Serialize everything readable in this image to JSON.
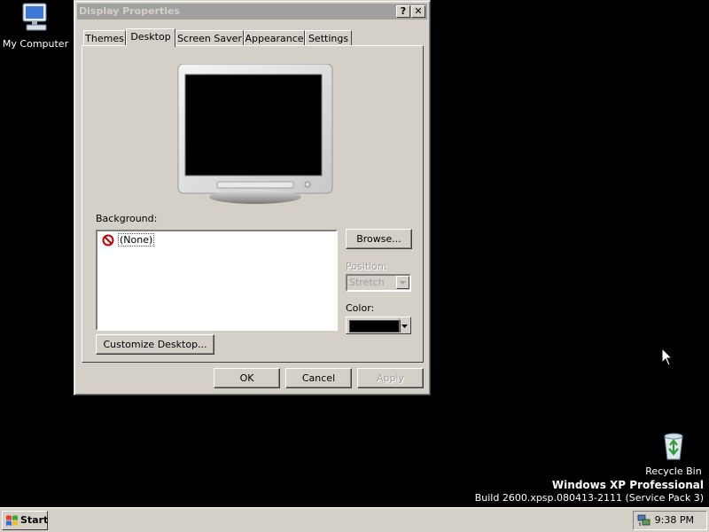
{
  "desktop": {
    "icons": [
      {
        "label": "My Computer",
        "icon": "my-computer-icon"
      },
      {
        "label": "Recycle Bin",
        "icon": "recycle-bin-icon"
      }
    ],
    "watermark": {
      "line1": "Windows XP Professional",
      "line2": "Build 2600.xpsp.080413-2111 (Service Pack 3)"
    }
  },
  "window": {
    "title": "Display Properties",
    "help_label": "?",
    "close_label": "✕",
    "tabs": [
      {
        "label": "Themes",
        "active": false
      },
      {
        "label": "Desktop",
        "active": true
      },
      {
        "label": "Screen Saver",
        "active": false
      },
      {
        "label": "Appearance",
        "active": false
      },
      {
        "label": "Settings",
        "active": false
      }
    ],
    "background": {
      "label": "Background:",
      "items": [
        {
          "label": "(None)",
          "icon": "no-symbol-icon",
          "selected": true
        }
      ]
    },
    "browse_label": "Browse...",
    "position": {
      "label": "Position:",
      "value": "Stretch",
      "disabled": true
    },
    "color": {
      "label": "Color:",
      "value": "#000000"
    },
    "customize_label": "Customize Desktop...",
    "ok_label": "OK",
    "cancel_label": "Cancel",
    "apply_label": "Apply"
  },
  "taskbar": {
    "start_label": "Start",
    "clock": "9:38 PM",
    "tray_icons": [
      "network-icon"
    ]
  }
}
